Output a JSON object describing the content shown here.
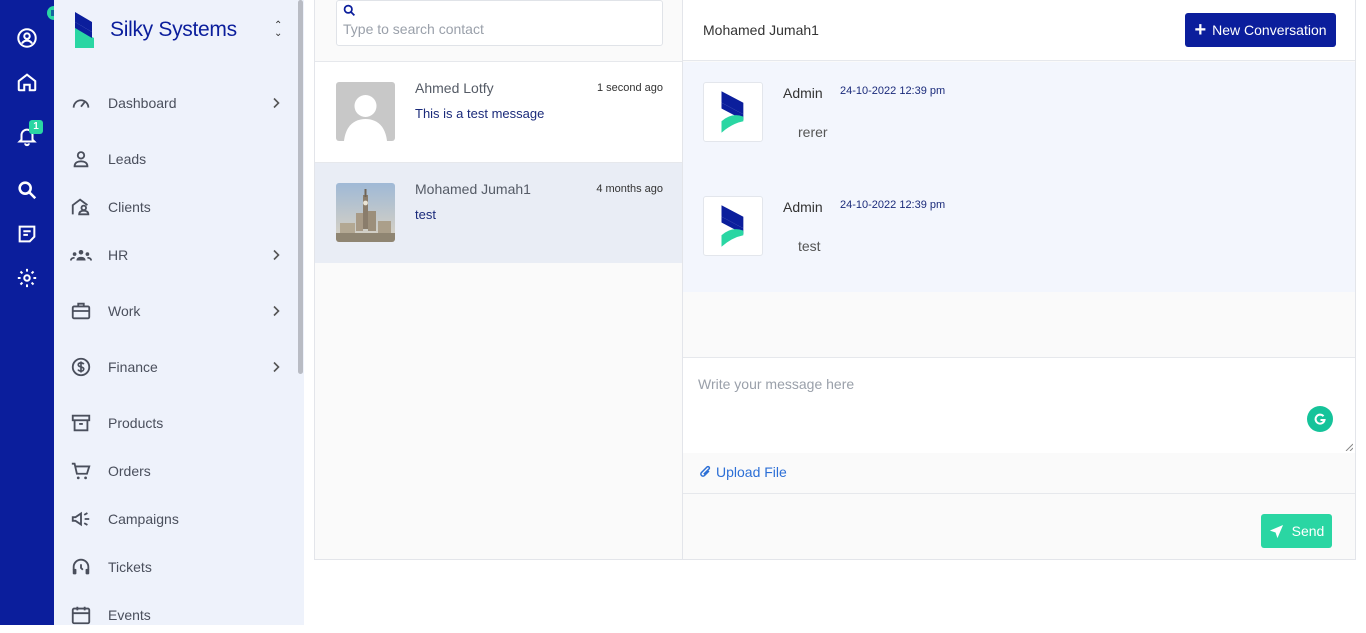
{
  "brand": {
    "name": "Silky Systems"
  },
  "rail": {
    "notification_count": "1",
    "icons": [
      "profile-icon",
      "home-icon",
      "bell-icon",
      "search-icon",
      "notes-icon",
      "settings-icon"
    ]
  },
  "sidebar": {
    "items": [
      {
        "label": "Dashboard",
        "icon": "dashboard-icon",
        "has_children": true
      },
      {
        "label": "Leads",
        "icon": "person-icon",
        "has_children": false
      },
      {
        "label": "Clients",
        "icon": "client-icon",
        "has_children": false
      },
      {
        "label": "HR",
        "icon": "group-icon",
        "has_children": true
      },
      {
        "label": "Work",
        "icon": "briefcase-icon",
        "has_children": true
      },
      {
        "label": "Finance",
        "icon": "dollar-icon",
        "has_children": true
      },
      {
        "label": "Products",
        "icon": "archive-icon",
        "has_children": false
      },
      {
        "label": "Orders",
        "icon": "cart-icon",
        "has_children": false
      },
      {
        "label": "Campaigns",
        "icon": "megaphone-icon",
        "has_children": false
      },
      {
        "label": "Tickets",
        "icon": "headset-icon",
        "has_children": false
      },
      {
        "label": "Events",
        "icon": "calendar-icon",
        "has_children": false
      }
    ]
  },
  "contacts": {
    "search_placeholder": "Type to search contact",
    "list": [
      {
        "name": "Ahmed Lotfy",
        "time": "1 second ago",
        "last_message": "This is a test message"
      },
      {
        "name": "Mohamed Jumah1",
        "time": "4 months ago",
        "last_message": "test"
      }
    ]
  },
  "chat": {
    "title": "Mohamed Jumah1",
    "new_conversation_label": "New Conversation",
    "messages": [
      {
        "author": "Admin",
        "date": "24-10-2022 12:39 pm",
        "text": "rerer"
      },
      {
        "author": "Admin",
        "date": "24-10-2022 12:39 pm",
        "text": "test"
      }
    ],
    "composer_placeholder": "Write your message here",
    "upload_label": "Upload File",
    "send_label": "Send"
  },
  "colors": {
    "primary": "#0b1e9c",
    "accent": "#2ad6a3",
    "link": "#2c6fd6"
  }
}
